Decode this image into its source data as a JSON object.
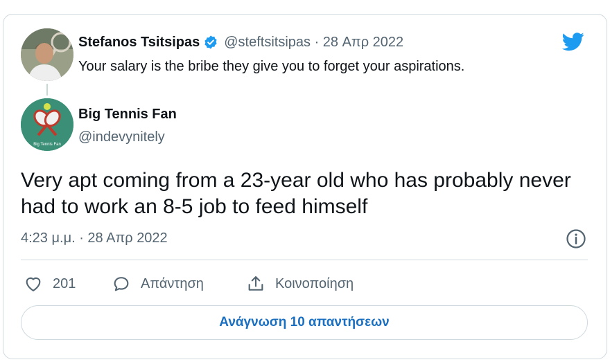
{
  "quoted_tweet": {
    "display_name": "Stefanos Tsitsipas",
    "handle_date": "@steftsitsipas · 28 Απρ 2022",
    "text": "Your salary is the bribe they give you to forget your aspirations."
  },
  "tweet": {
    "display_name": "Big Tennis Fan",
    "handle": "@indevynitely",
    "avatar_text": "Big Tennis Fan",
    "text": "Very apt coming from a 23-year old who has probably never had to work an 8-5 job to feed himself",
    "timestamp": "4:23 μ.μ. · 28 Απρ 2022"
  },
  "actions": {
    "like_count": "201",
    "reply_label": "Απάντηση",
    "share_label": "Κοινοποίηση"
  },
  "read_replies_label": "Ανάγνωση 10 απαντήσεων",
  "icons": {
    "brand": "twitter-bird-icon",
    "verified": "verified-badge-icon",
    "info": "info-icon",
    "like": "heart-icon",
    "reply": "comment-bubble-icon",
    "share": "share-upload-icon"
  },
  "colors": {
    "twitter_blue": "#1d9bf0",
    "link_blue": "#1b6fc1",
    "muted_text": "#536471",
    "border": "#cfd9de"
  }
}
